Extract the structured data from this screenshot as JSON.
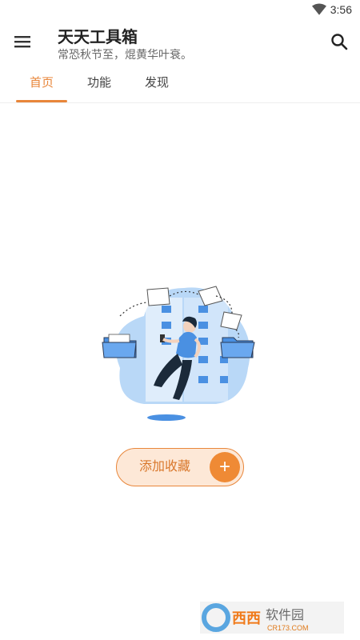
{
  "status_bar": {
    "time": "3:56"
  },
  "app_bar": {
    "title": "天天工具箱",
    "subtitle": "常恐秋节至，焜黄华叶衰。",
    "menu_icon": "menu-icon",
    "search_icon": "search-icon"
  },
  "tabs": [
    {
      "label": "首页",
      "active": true
    },
    {
      "label": "功能",
      "active": false
    },
    {
      "label": "发现",
      "active": false
    }
  ],
  "add_button": {
    "label": "添加收藏",
    "icon": "plus-icon"
  },
  "colors": {
    "accent": "#e8863a",
    "accent_light": "#fde8d7",
    "illustration_blue": "#b9d8f7"
  },
  "watermark": {
    "text": "西西软件园",
    "subtext": "CR173.COM"
  }
}
